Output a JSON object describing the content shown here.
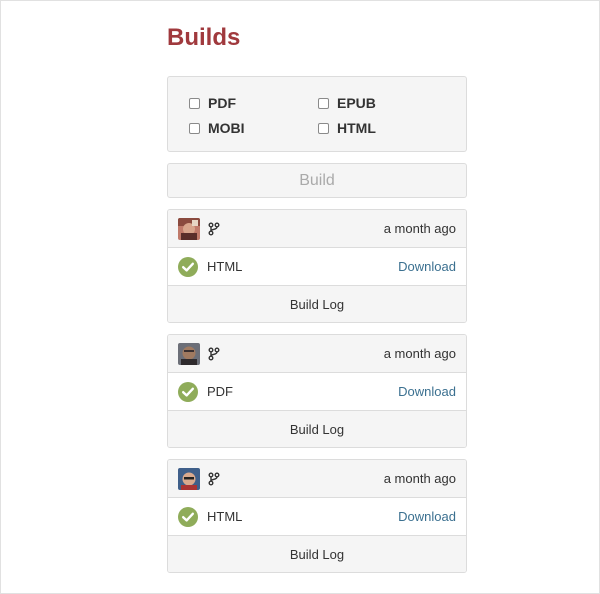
{
  "header": {
    "title": "Builds"
  },
  "formats": [
    {
      "label": "PDF",
      "checked": false
    },
    {
      "label": "EPUB",
      "checked": false
    },
    {
      "label": "MOBI",
      "checked": false
    },
    {
      "label": "HTML",
      "checked": false
    }
  ],
  "build_button": {
    "label": "Build",
    "state": "disabled"
  },
  "builds": [
    {
      "time": "a month ago",
      "format": "HTML",
      "status": "success",
      "download_label": "Download",
      "log_label": "Build Log",
      "avatar_icon": "user-avatar-icon",
      "branch_icon": "branch-icon"
    },
    {
      "time": "a month ago",
      "format": "PDF",
      "status": "success",
      "download_label": "Download",
      "log_label": "Build Log",
      "avatar_icon": "user-avatar-icon",
      "branch_icon": "branch-icon"
    },
    {
      "time": "a month ago",
      "format": "HTML",
      "status": "success",
      "download_label": "Download",
      "log_label": "Build Log",
      "avatar_icon": "user-avatar-icon",
      "branch_icon": "branch-icon"
    }
  ],
  "colors": {
    "title": "#a0393d",
    "success": "#8fac5a",
    "link": "#3b7090",
    "panel_bg": "#f5f5f5",
    "border": "#dcdcdc"
  }
}
